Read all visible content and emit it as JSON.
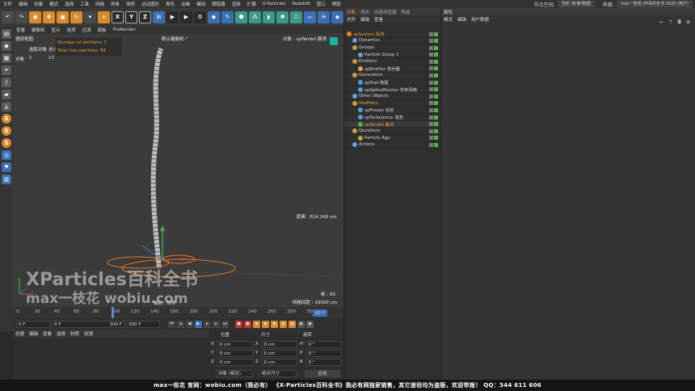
{
  "menubar": {
    "items": [
      "文件",
      "编辑",
      "创建",
      "模式",
      "选择",
      "工具",
      "网格",
      "样条",
      "体积",
      "运动图形",
      "角色",
      "动画",
      "模拟",
      "跟踪器",
      "渲染",
      "扩展",
      "X-Particles",
      "Redshift",
      "窗口",
      "帮助"
    ],
    "node_space_label": "节点空间:",
    "node_space_value": "当前 (标准/物理)",
    "layout_label": "界面:",
    "layout_value": "max一枝花-XP百科全书-1920 (用户)"
  },
  "toolbar": {
    "icons": [
      "undo-icon",
      "redo-icon",
      "live-select-icon",
      "move-icon",
      "scale-icon",
      "rotate-icon",
      "recent-tools-icon",
      "add-icon",
      "x-axis-icon",
      "y-axis-icon",
      "z-axis-icon",
      "coordinate-system-icon",
      "render-view-icon",
      "render-picture-icon",
      "render-settings-icon",
      "cube-icon",
      "pen-icon",
      "subdivision-icon",
      "cloner-icon",
      "deformer-icon",
      "effector-icon",
      "scene-icon",
      "camera-icon",
      "light-icon",
      "tag-icon",
      "grid-icon",
      "floor-icon"
    ],
    "axes": [
      "X",
      "Y",
      "Z"
    ]
  },
  "leftbar": {
    "icons": [
      "make-editable-icon",
      "model-mode-icon",
      "texture-mode-icon",
      "points-mode-icon",
      "edges-mode-icon",
      "polygons-mode-icon",
      "axis-mode-icon",
      "solo-icon",
      "snap-icon",
      "workplane-icon",
      "magnet-icon",
      "layers-icon",
      "lock-icon"
    ],
    "s_labels": [
      "S",
      "S",
      "S"
    ]
  },
  "viewport_menu": [
    "查看",
    "摄像机",
    "显示",
    "选项",
    "过滤",
    "面板",
    "ProRender"
  ],
  "viewport": {
    "view_name": "透视视图",
    "camera_label": "默认摄像机",
    "camera_suffix": "·°",
    "selected_label": "选取对象",
    "total_label": "总计",
    "objects_label": "对象",
    "objects_count_a": "1",
    "objects_count_b": "17",
    "hud_emitters": "Number of emitters: 1",
    "hud_particles": "Total live particles: 81",
    "object_label": "对象 : xpTendril 藤须",
    "distance": "距离 : 614.249 cm",
    "fps": "帧 : 93",
    "grid_spacing": "网格间距 : 10000 cm",
    "axes_label": "轴向 : 世界",
    "watermark_big": "XParticles百科全书",
    "watermark_small": "max一枝花 wobiu.com"
  },
  "timeline": {
    "ticks": [
      "0",
      "20",
      "40",
      "60",
      "80",
      "100",
      "120",
      "140",
      "160",
      "180",
      "200",
      "220",
      "240",
      "260",
      "280",
      "300"
    ],
    "current_frame": "92 F"
  },
  "playbar": {
    "start": "0 F",
    "min": "0 F",
    "max": "300 F",
    "end": "300 F",
    "buttons": [
      "go-start-icon",
      "prev-key-icon",
      "play-back-icon",
      "play-icon",
      "next-frame-icon",
      "next-key-icon",
      "go-end-icon"
    ],
    "rec_buttons": [
      "record-icon",
      "autokey-icon",
      "keyframe-sel-icon",
      "position-key-icon",
      "rotation-key-icon",
      "scale-key-icon",
      "param-key-icon",
      "pla-key-icon",
      "motion-icon"
    ]
  },
  "materials": {
    "menu": [
      "创建",
      "编辑",
      "查看",
      "选择",
      "材质",
      "纹理"
    ]
  },
  "coordinates": {
    "headers": [
      "位置",
      "尺寸",
      "旋转"
    ],
    "rows": [
      {
        "ax1": "X",
        "v1": "0 cm",
        "ax2": "X",
        "v2": "0 cm",
        "ax3": "H",
        "v3": "0 °"
      },
      {
        "ax1": "Y",
        "v1": "0 cm",
        "ax2": "Y",
        "v2": "0 cm",
        "ax3": "P",
        "v3": "0 °"
      },
      {
        "ax1": "Z",
        "v1": "0 cm",
        "ax2": "Z",
        "v2": "0 cm",
        "ax3": "B",
        "v3": "0 °"
      }
    ],
    "mode_object": "对象 (相对)",
    "mode_size": "绝对尺寸",
    "apply": "应用"
  },
  "object_manager": {
    "tabs": [
      "对象",
      "场次",
      "内容浏览器",
      "构造"
    ],
    "menu": [
      "文件",
      "编辑",
      "查看"
    ],
    "items": [
      {
        "name": "xpSystem 系统",
        "indent": 0,
        "color": "#e8a33a",
        "icon_color": "#d98a2b"
      },
      {
        "name": "Dynamics",
        "indent": 1,
        "color": "#d8d8d8",
        "icon_color": "#6aa0d8"
      },
      {
        "name": "Groups",
        "indent": 1,
        "color": "#d8d8d8",
        "icon_color": "#c8a040"
      },
      {
        "name": "Particle Group 1",
        "indent": 2,
        "color": "#d8d8d8",
        "icon_color": "#6aa0d8"
      },
      {
        "name": "Emitters",
        "indent": 1,
        "color": "#d8d8d8",
        "icon_color": "#c8a040"
      },
      {
        "name": "xpEmitter 发射器",
        "indent": 2,
        "color": "#d8d8d8",
        "icon_color": "#e8a33a"
      },
      {
        "name": "Generators",
        "indent": 1,
        "color": "#d8d8d8",
        "icon_color": "#c8a040"
      },
      {
        "name": "xpTrail 拖尾",
        "indent": 2,
        "color": "#d8d8d8",
        "icon_color": "#4aa0d8"
      },
      {
        "name": "xpSplineMesher 样条网格",
        "indent": 2,
        "color": "#d8d8d8",
        "icon_color": "#4aa0d8"
      },
      {
        "name": "Other Objects",
        "indent": 1,
        "color": "#d8d8d8",
        "icon_color": "#6aa0d8"
      },
      {
        "name": "Modifiers",
        "indent": 1,
        "color": "#e8a33a",
        "icon_color": "#c8a040"
      },
      {
        "name": "xpFreeze 冻结",
        "indent": 2,
        "color": "#d8d8d8",
        "icon_color": "#4aa0d8"
      },
      {
        "name": "xpTurbulence 湍流",
        "indent": 2,
        "color": "#d8d8d8",
        "icon_color": "#4aa0d8"
      },
      {
        "name": "xpTendril 藤须",
        "indent": 2,
        "color": "#e8a33a",
        "icon_color": "#4ab848"
      },
      {
        "name": "Questions",
        "indent": 1,
        "color": "#d8d8d8",
        "icon_color": "#c8a040"
      },
      {
        "name": "Particle Age",
        "indent": 2,
        "color": "#d8d8d8",
        "icon_color": "#c8a040"
      },
      {
        "name": "Actions",
        "indent": 1,
        "color": "#d8d8d8",
        "icon_color": "#6aa0d8"
      }
    ]
  },
  "attributes": {
    "tab": "属性",
    "menu": [
      "模式",
      "编辑",
      "用户数据"
    ]
  },
  "banner": {
    "text": "max一枝花 官网：wobiu.com（我必有）    《X-Particles百科全书》我必有网独家销售，其它途径均为盗版，欢迎举报！    QQ：344 611 606"
  },
  "colors": {
    "accent": "#e8a33a",
    "toolbar_blue": "#3b6fb5",
    "toolbar_orange": "#d98a2b",
    "green": "#59b34c"
  }
}
